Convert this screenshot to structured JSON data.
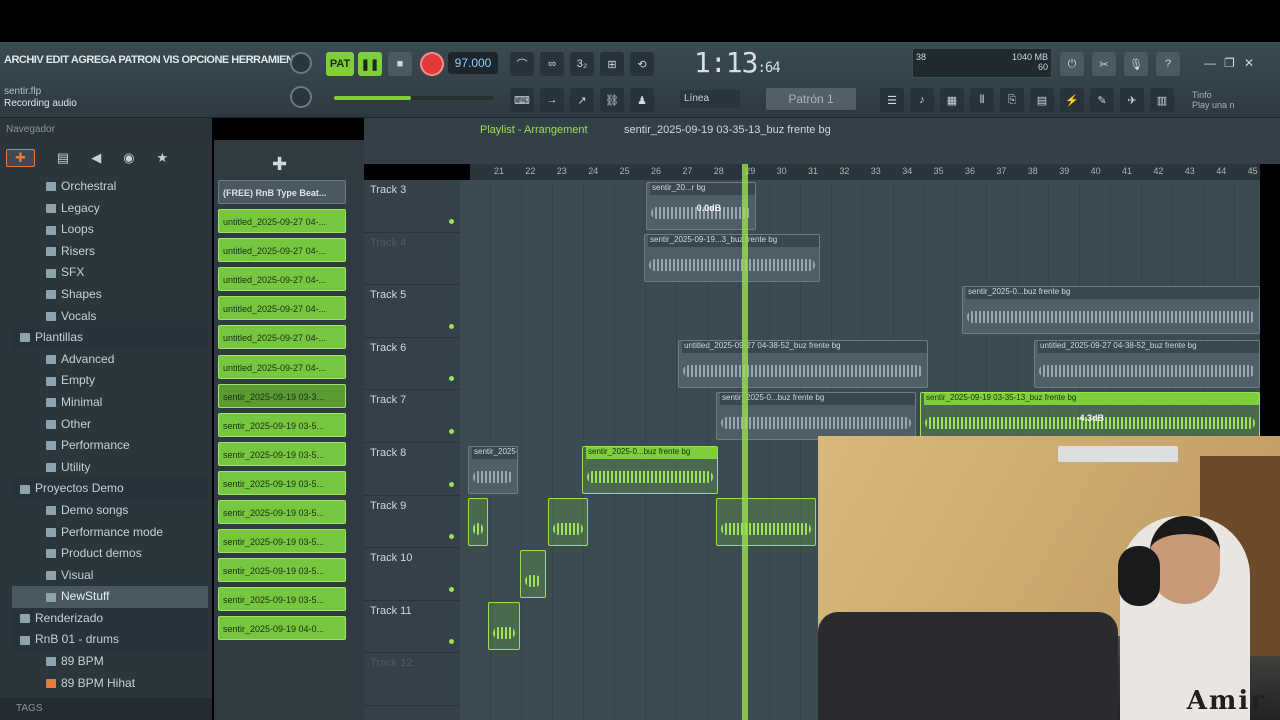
{
  "menu": "ARCHIV EDIT AGREGA PATRON VIS OPCIONE HERRAMIENTA",
  "song": {
    "file": "sentir.flp",
    "status": "Recording audio"
  },
  "transport": {
    "pattern_btn": "PAT",
    "tempo": "97.000",
    "time": "1:13",
    "time_small": ":64",
    "snap": "Línea",
    "pattern": "Patrón 1"
  },
  "cpu": {
    "value": "38",
    "memory": "1040 MB",
    "poly": "60"
  },
  "hint": {
    "line1": "Tinfo",
    "line2": "Play una n"
  },
  "browser": {
    "header": "Navegador",
    "tabs": [
      "✚",
      "▤",
      "◀",
      "◉",
      "★"
    ],
    "items": [
      {
        "label": "Orchestral",
        "level": 1
      },
      {
        "label": "Legacy",
        "level": 1
      },
      {
        "label": "Loops",
        "level": 1
      },
      {
        "label": "Risers",
        "level": 1
      },
      {
        "label": "SFX",
        "level": 1
      },
      {
        "label": "Shapes",
        "level": 1
      },
      {
        "label": "Vocals",
        "level": 1
      },
      {
        "label": "Plantillas",
        "level": 0
      },
      {
        "label": "Advanced",
        "level": 1
      },
      {
        "label": "Empty",
        "level": 1
      },
      {
        "label": "Minimal",
        "level": 1
      },
      {
        "label": "Other",
        "level": 1
      },
      {
        "label": "Performance",
        "level": 1
      },
      {
        "label": "Utility",
        "level": 1
      },
      {
        "label": "Proyectos Demo",
        "level": 0
      },
      {
        "label": "Demo songs",
        "level": 1
      },
      {
        "label": "Performance mode",
        "level": 1
      },
      {
        "label": "Product demos",
        "level": 1
      },
      {
        "label": "Visual",
        "level": 1
      },
      {
        "label": "NewStuff",
        "level": 1
      },
      {
        "label": "Renderizado",
        "level": 0
      },
      {
        "label": "RnB 01 - drums",
        "level": 0
      },
      {
        "label": "89 BPM",
        "level": 1
      },
      {
        "label": "89 BPM Hihat",
        "level": 1
      }
    ],
    "tags_label": "TAGS"
  },
  "playlist": {
    "title": "Playlist - Arrangement",
    "file": "sentir_2025-09-19 03-35-13_buz frente bg"
  },
  "picker": {
    "add": "✚",
    "clips": [
      "(FREE) RnB Type Beat...",
      "untitled_2025-09-27 04-...",
      "untitled_2025-09-27 04-...",
      "untitled_2025-09-27 04-...",
      "untitled_2025-09-27 04-...",
      "untitled_2025-09-27 04-...",
      "untitled_2025-09-27 04-...",
      "sentir_2025-09-19 03-3...",
      "sentir_2025-09-19 03-5...",
      "sentir_2025-09-19 03-5...",
      "sentir_2025-09-19 03-5...",
      "sentir_2025-09-19 03-5...",
      "sentir_2025-09-19 03-5...",
      "sentir_2025-09-19 03-5...",
      "sentir_2025-09-19 03-5...",
      "sentir_2025-09-19 04-0..."
    ]
  },
  "tracks": [
    "Track 3",
    "Track 4",
    "Track 5",
    "Track 6",
    "Track 7",
    "Track 8",
    "Track 9",
    "Track 10",
    "Track 11",
    "Track 12"
  ],
  "ruler": [
    "21",
    "22",
    "23",
    "24",
    "25",
    "26",
    "27",
    "28",
    "29",
    "30",
    "31",
    "32",
    "33",
    "34",
    "35",
    "36",
    "37",
    "38",
    "39",
    "40",
    "41",
    "42",
    "43",
    "44",
    "45"
  ],
  "clips_top": [
    {
      "label": "sentir_20...r bg",
      "db": "0.0dB"
    },
    {
      "label": "sentir_2025-09-19...3_buz frente bg",
      "db": ""
    },
    {
      "label": "sentir_2025-09-19 03-35-13_buz frente bg",
      "db": "-4.3dB"
    },
    {
      "label": "sentir_2025-0...buz frente bg",
      "db": ""
    },
    {
      "label": "untitled_2025-09-27 04-38-52_buz frente bg",
      "db": ""
    }
  ],
  "shirt_text": "Amir"
}
